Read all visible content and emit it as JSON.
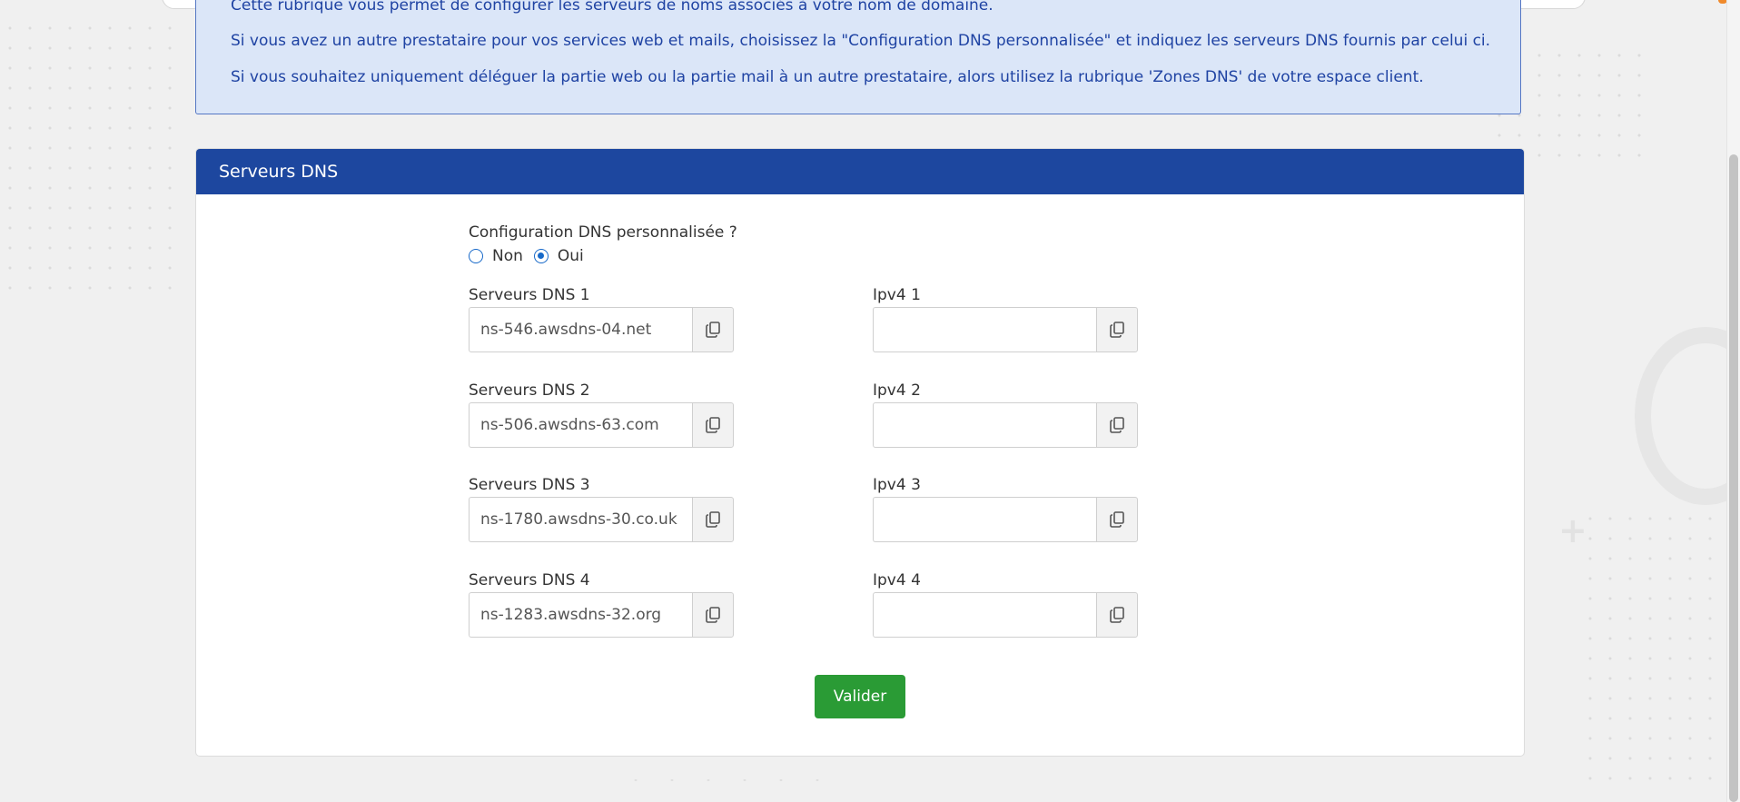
{
  "info": {
    "line1": "Cette rubrique vous permet de configurer les serveurs de noms associés à votre nom de domaine.",
    "line2": "Si vous avez un autre prestataire pour vos services web et mails, choisissez la \"Configuration DNS personnalisée\" et indiquez les serveurs DNS fournis par celui ci.",
    "line3": "Si vous souhaitez uniquement déléguer la partie web ou la partie mail à un autre prestataire, alors utilisez la rubrique 'Zones DNS' de votre espace client."
  },
  "card": {
    "title": "Serveurs DNS",
    "question": "Configuration DNS personnalisée ?",
    "radio_non": "Non",
    "radio_oui": "Oui",
    "selected": "Oui",
    "dns": [
      {
        "label": "Serveurs DNS 1",
        "value": "ns-546.awsdns-04.net"
      },
      {
        "label": "Serveurs DNS 2",
        "value": "ns-506.awsdns-63.com"
      },
      {
        "label": "Serveurs DNS 3",
        "value": "ns-1780.awsdns-30.co.uk"
      },
      {
        "label": "Serveurs DNS 4",
        "value": "ns-1283.awsdns-32.org"
      }
    ],
    "ipv4": [
      {
        "label": "Ipv4 1",
        "value": ""
      },
      {
        "label": "Ipv4 2",
        "value": ""
      },
      {
        "label": "Ipv4 3",
        "value": ""
      },
      {
        "label": "Ipv4 4",
        "value": ""
      }
    ],
    "submit_label": "Valider"
  },
  "colors": {
    "header_bg": "#1d479f",
    "info_bg": "#dbe6f8",
    "info_text": "#1f43a3",
    "submit_bg": "#2a9b35",
    "radio": "#1769c9"
  },
  "icons": {
    "copy": "copy-icon"
  }
}
